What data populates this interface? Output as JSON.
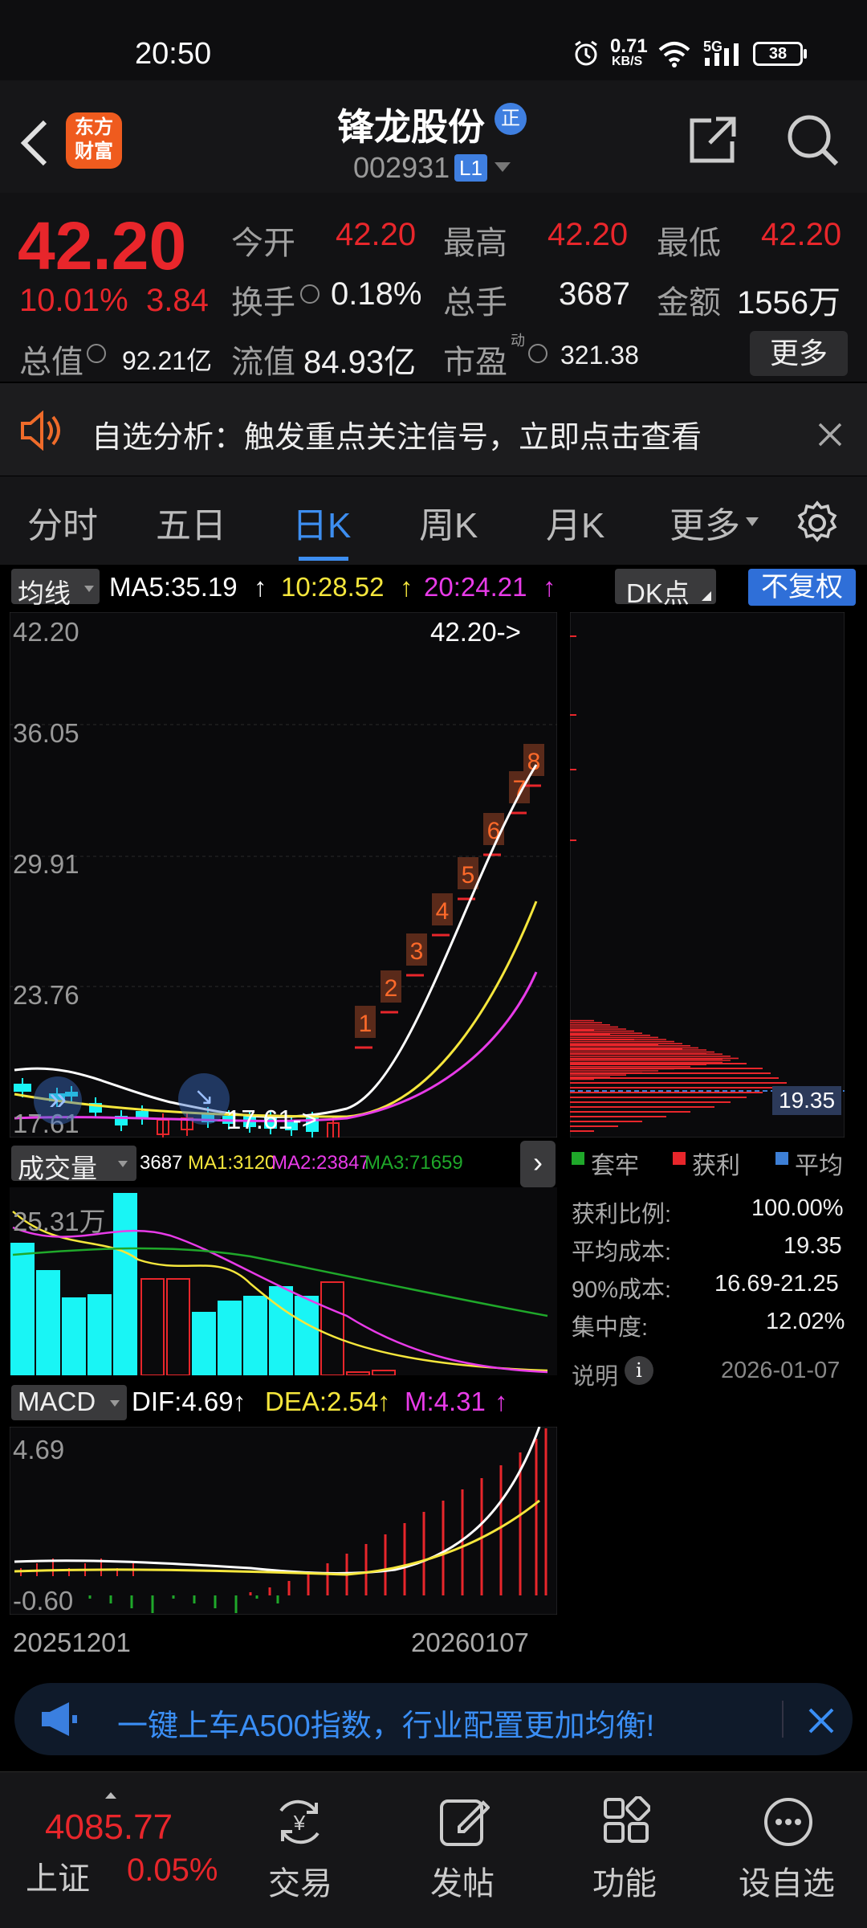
{
  "status_bar": {
    "time": "20:50",
    "net_speed": "0.71",
    "net_unit": "KB/S",
    "signal": "5G",
    "battery": "38"
  },
  "header": {
    "logo_line1": "东方",
    "logo_line2": "财富",
    "stock_name": "锋龙股份",
    "badge": "正",
    "stock_code": "002931",
    "level": "L1"
  },
  "quote": {
    "price": "42.20",
    "change_pct": "10.01%",
    "change": "3.84",
    "open_label": "今开",
    "open": "42.20",
    "high_label": "最高",
    "high": "42.20",
    "low_label": "最低",
    "low": "42.20",
    "turnover_label": "换手",
    "turnover": "0.18%",
    "volume_label": "总手",
    "volume": "3687",
    "amount_label": "金额",
    "amount": "1556万",
    "mktcap_label": "总值",
    "mktcap": "92.21亿",
    "float_label": "流值",
    "float": "84.93亿",
    "pe_label": "市盈",
    "pe_sup": "动",
    "pe": "321.38",
    "more_label": "更多"
  },
  "notice": {
    "text": "自选分析：触发重点关注信号，立即点击查看"
  },
  "tabs": [
    "分时",
    "五日",
    "日K",
    "周K",
    "月K",
    "更多"
  ],
  "active_tab": "日K",
  "kline": {
    "ma_label": "均线",
    "ma5": "MA5:35.19",
    "ma10": "10:28.52",
    "ma20": "20:24.21",
    "dk_label": "DK点",
    "fq_label": "不复权",
    "y_ticks": [
      "42.20",
      "36.05",
      "29.91",
      "23.76",
      "17.61"
    ],
    "high_marker": "42.20->",
    "low_marker": "17.61->",
    "step_labels": [
      "1",
      "2",
      "3",
      "4",
      "5",
      "6",
      "7",
      "8"
    ]
  },
  "chip": {
    "legend": [
      "套牢",
      "获利",
      "平均"
    ],
    "avg_price": "19.35",
    "rows": [
      {
        "label": "获利比例:",
        "value": "100.00%"
      },
      {
        "label": "平均成本:",
        "value": "19.35"
      },
      {
        "label": "90%成本:",
        "value": "16.69-21.25"
      },
      {
        "label": "集中度:",
        "value": "12.02%"
      }
    ],
    "note_label": "说明",
    "date": "2026-01-07"
  },
  "volume": {
    "label": "成交量",
    "v": "3687",
    "ma1": "MA1:3120",
    "ma2": "MA2:23847",
    "ma3": "MA3:71659",
    "max": "25.31万"
  },
  "macd": {
    "label": "MACD",
    "dif": "DIF:4.69",
    "dea": "DEA:2.54",
    "m": "M:4.31",
    "top": "4.69",
    "bottom": "-0.60"
  },
  "dates": {
    "start": "20251201",
    "end": "20260107"
  },
  "ad": {
    "text": "一键上车A500指数，行业配置更加均衡!"
  },
  "bottom_nav": {
    "index_value": "4085.77",
    "index_name": "上证",
    "index_change": "0.05%",
    "items": [
      "交易",
      "发帖",
      "功能",
      "设自选"
    ]
  },
  "colors": {
    "red": "#e8262b",
    "cyan": "#19f5f5",
    "yellow": "#f5e63c",
    "magenta": "#e83be8",
    "green": "#1fa82a",
    "blue": "#3d7fd6"
  }
}
